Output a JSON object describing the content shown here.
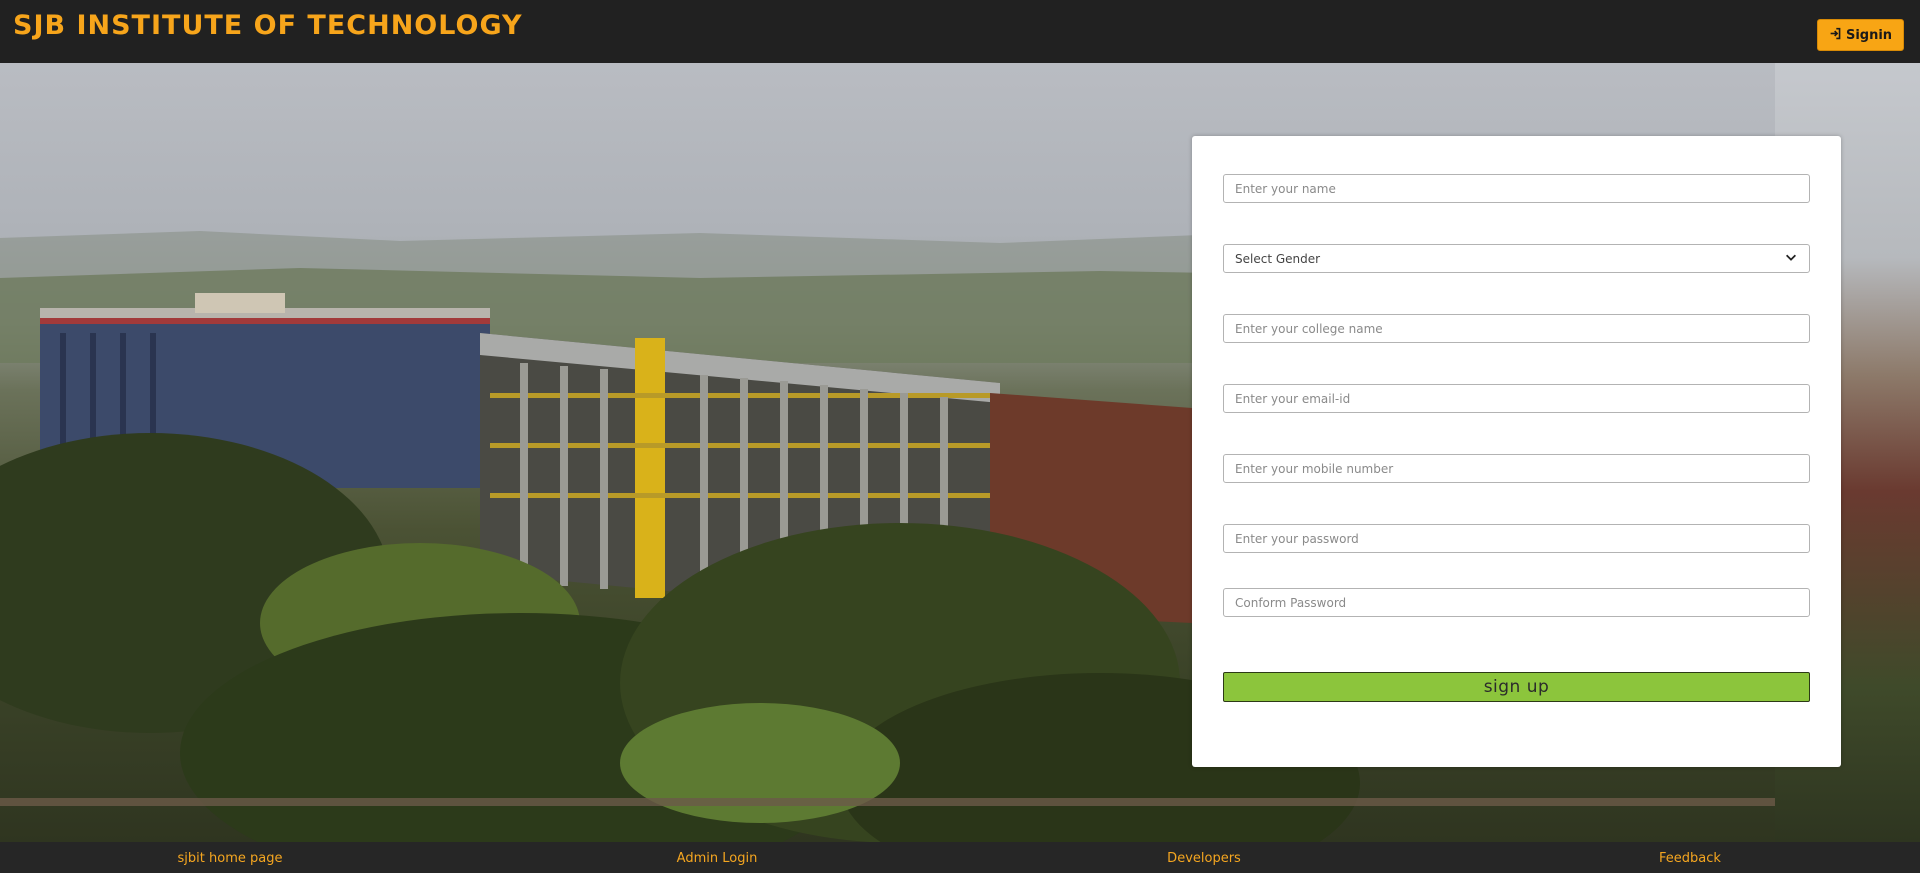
{
  "header": {
    "brand": "SJB INSTITUTE OF TECHNOLOGY",
    "signin_label": "Signin",
    "signin_icon": "sign-in-icon"
  },
  "form": {
    "name_placeholder": "Enter your name",
    "gender_selected": "Select Gender",
    "college_placeholder": "Enter your college name",
    "email_placeholder": "Enter your email-id",
    "mobile_placeholder": "Enter your mobile number",
    "password_placeholder": "Enter your password",
    "confirm_placeholder": "Conform Password",
    "submit_label": "sign up"
  },
  "footer": {
    "links": [
      "sjbit home page",
      "Admin Login",
      "Developers",
      "Feedback"
    ]
  },
  "colors": {
    "brand": "#f7a51b",
    "header_bg": "#212121",
    "signin_bg": "#f8a514",
    "submit_bg": "#8cc53c",
    "footer_link": "#f5a620"
  }
}
